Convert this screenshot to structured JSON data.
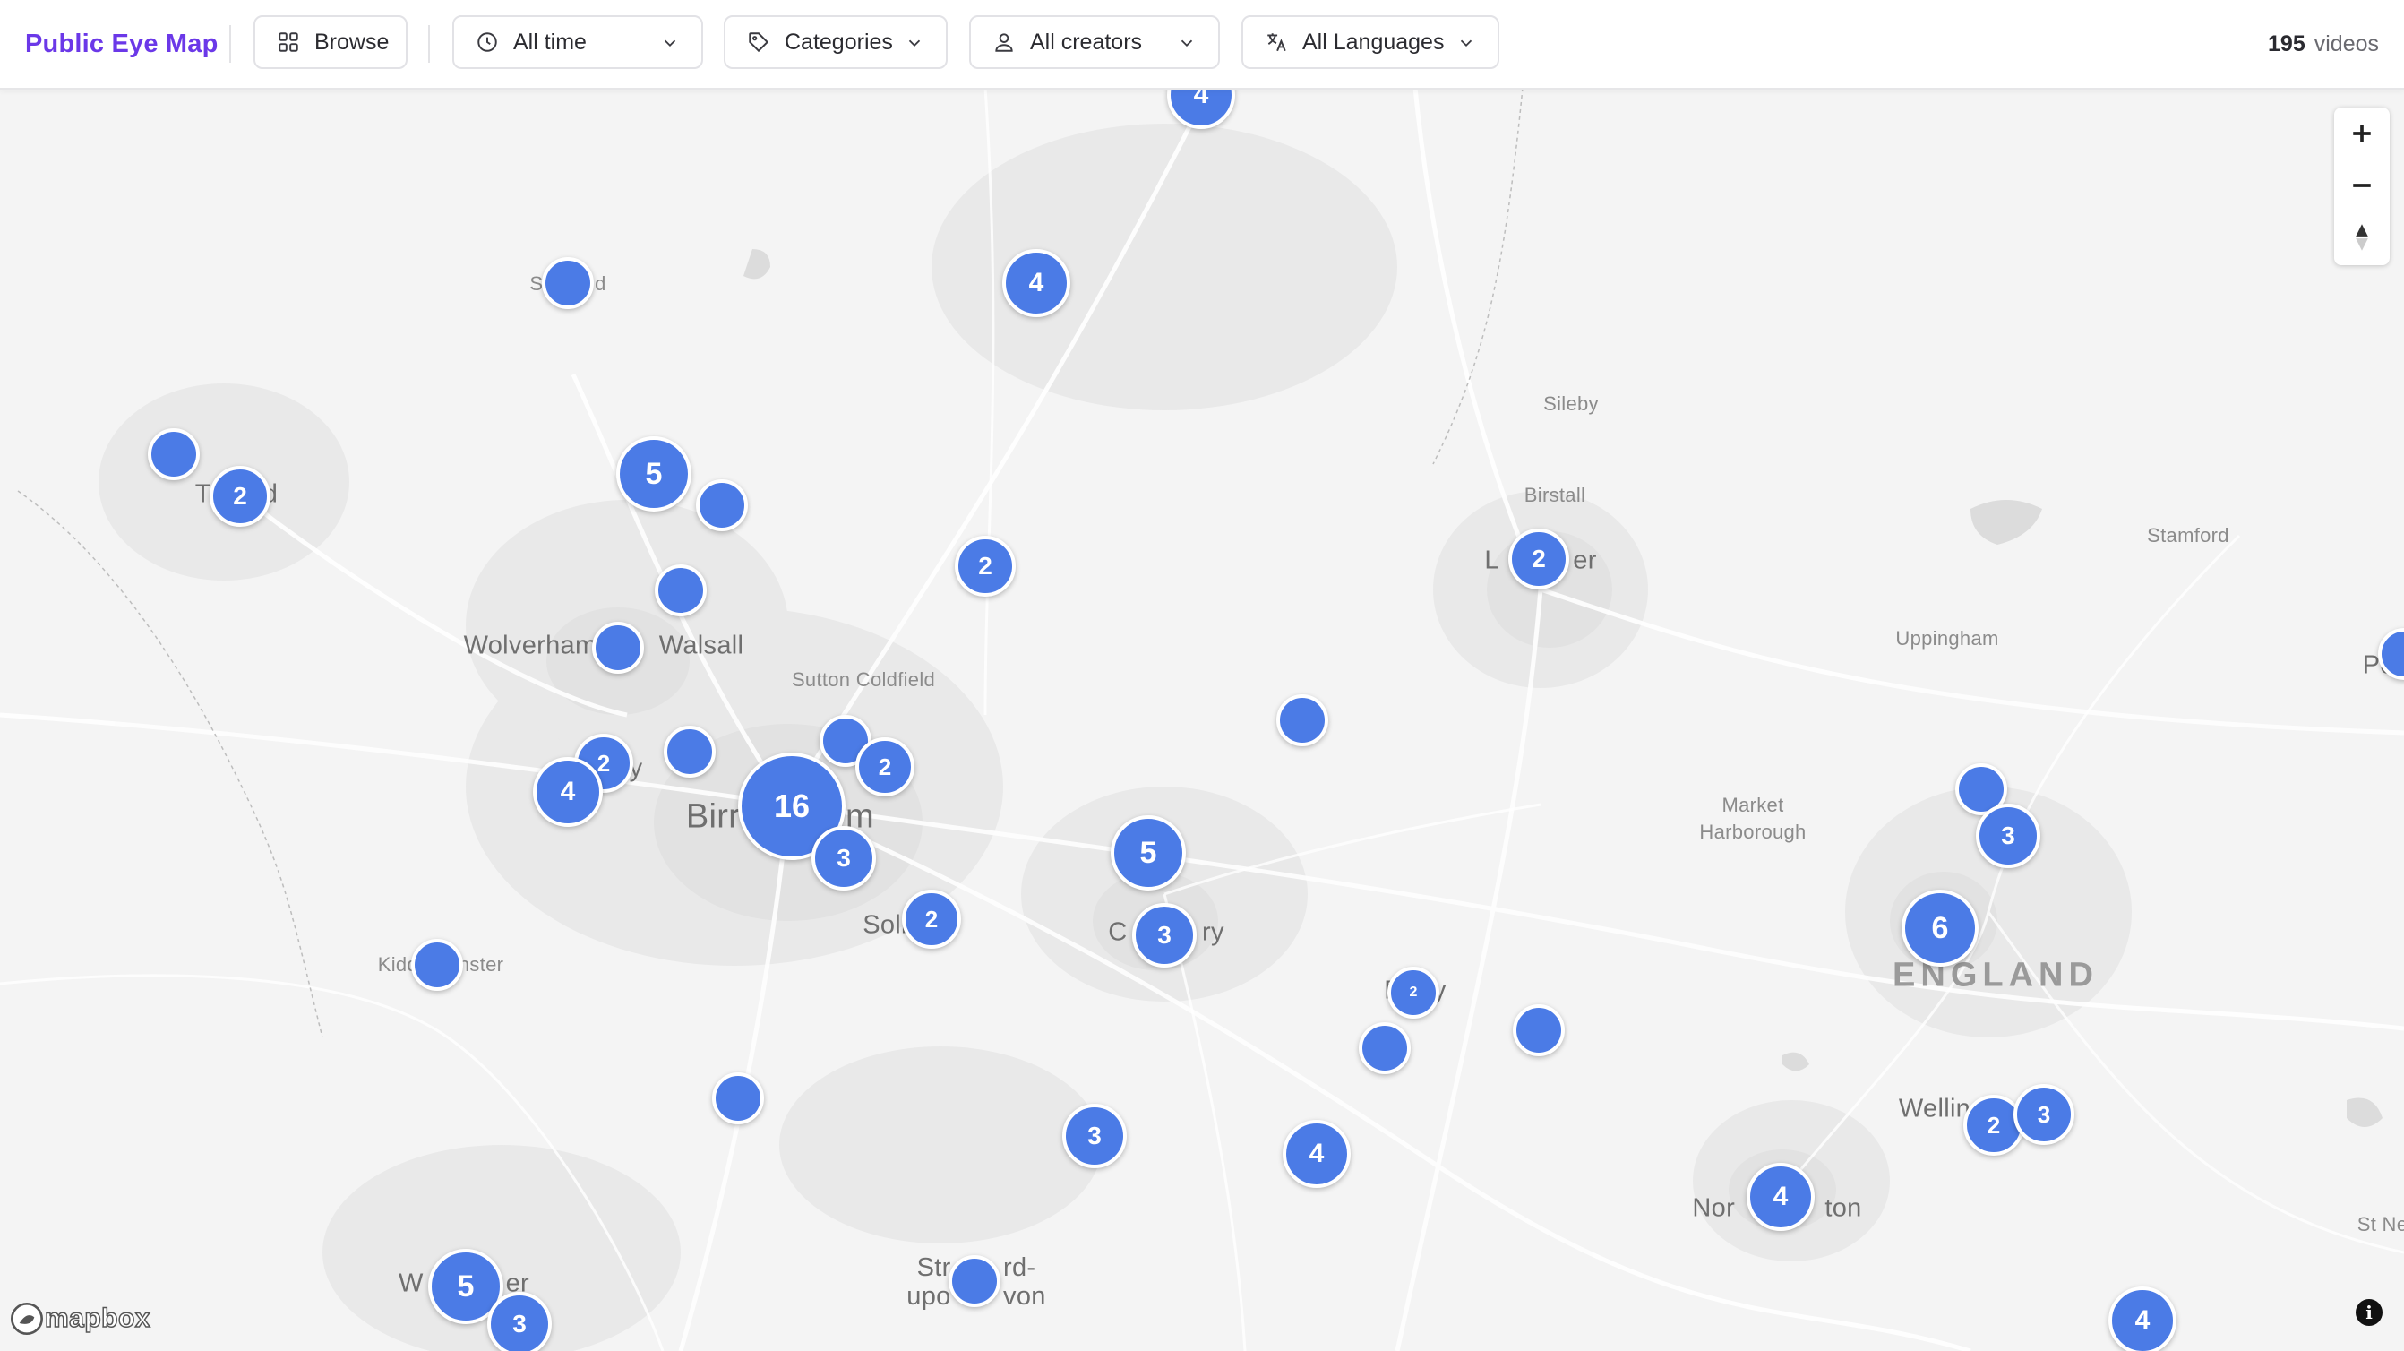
{
  "header": {
    "brand": "Public Eye Map",
    "browse_label": "Browse",
    "time_filter": "All time",
    "category_filter": "Categories",
    "creator_filter": "All creators",
    "language_filter": "All Languages",
    "video_count": "195",
    "video_count_label": "videos"
  },
  "map": {
    "attribution_logo": "mapbox",
    "controls": [
      "zoom-in",
      "zoom-out",
      "compass"
    ],
    "place_labels": [
      {
        "id": "sileby",
        "text": "Sileby"
      },
      {
        "id": "birstall",
        "text": "Birstall"
      },
      {
        "id": "stamford",
        "text": "Stamford"
      },
      {
        "id": "uppingham",
        "text": "Uppingham"
      },
      {
        "id": "sutton-coldfield",
        "text": "Sutton Coldfield"
      },
      {
        "id": "wolverhampton",
        "text": "Wolverham"
      },
      {
        "id": "walsall",
        "text": "Walsall"
      },
      {
        "id": "birmingham-l",
        "text": "Birr"
      },
      {
        "id": "birmingham-r",
        "text": "m"
      },
      {
        "id": "solihull",
        "text": "Soli"
      },
      {
        "id": "market-harborough",
        "text": "Market\nHarborough"
      },
      {
        "id": "england",
        "text": "ENGLAND"
      },
      {
        "id": "kidderminster",
        "text": "Kidd       nster"
      },
      {
        "id": "stratford",
        "text": "Str       rd-\nupo       von"
      },
      {
        "id": "northampton",
        "text": "Nor            ton"
      },
      {
        "id": "wellingborough",
        "text": "Wellin"
      },
      {
        "id": "peterborough",
        "text": "Pete"
      },
      {
        "id": "st-neots",
        "text": "St Ne"
      },
      {
        "id": "leicester",
        "text": "L          er"
      },
      {
        "id": "coventry",
        "text": "C          ry"
      },
      {
        "id": "rugby",
        "text": "R    y"
      },
      {
        "id": "telford",
        "text": "T       d"
      },
      {
        "id": "stafford",
        "text": "S         d"
      },
      {
        "id": "worcester",
        "text": "W           er"
      },
      {
        "id": "dudley",
        "text": "y"
      }
    ],
    "clusters": [
      {
        "label": "4"
      },
      {
        "label": ""
      },
      {
        "label": "4"
      },
      {
        "label": ""
      },
      {
        "label": "2"
      },
      {
        "label": "5"
      },
      {
        "label": ""
      },
      {
        "label": "2"
      },
      {
        "label": ""
      },
      {
        "label": "2"
      },
      {
        "label": ""
      },
      {
        "label": ""
      },
      {
        "label": "2"
      },
      {
        "label": "4"
      },
      {
        "label": ""
      },
      {
        "label": ""
      },
      {
        "label": "2"
      },
      {
        "label": "16"
      },
      {
        "label": "3"
      },
      {
        "label": "5"
      },
      {
        "label": "2"
      },
      {
        "label": "3"
      },
      {
        "label": ""
      },
      {
        "label": "2"
      },
      {
        "label": ""
      },
      {
        "label": ""
      },
      {
        "label": ""
      },
      {
        "label": ""
      },
      {
        "label": "3"
      },
      {
        "label": "4"
      },
      {
        "label": ""
      },
      {
        "label": "3"
      },
      {
        "label": "6"
      },
      {
        "label": "2"
      },
      {
        "label": "3"
      },
      {
        "label": "4"
      },
      {
        "label": "5"
      },
      {
        "label": "3"
      },
      {
        "label": ""
      },
      {
        "label": "4"
      },
      {
        "label": ""
      }
    ]
  }
}
